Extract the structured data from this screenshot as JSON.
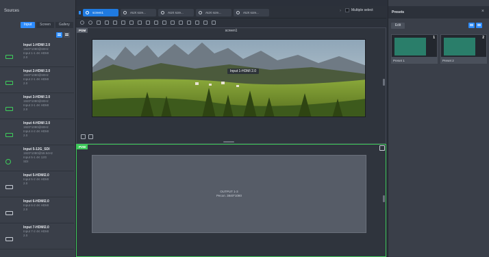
{
  "sources": {
    "title": "Sources",
    "tabs": [
      {
        "label": "Input",
        "active": true
      },
      {
        "label": "Screen",
        "active": false
      },
      {
        "label": "Gallery",
        "active": false
      }
    ],
    "items": [
      {
        "name": "Input 1-HDMI 2.0",
        "line1": "1920*1080@60Hz",
        "line2": "Input 1-1  4K  HDMI",
        "line3": "2.0",
        "icon": "hdmi-icon"
      },
      {
        "name": "Input 2-HDMI 2.0",
        "line1": "1920*1080@60Hz",
        "line2": "Input 2-1  4K  HDMI",
        "line3": "2.0",
        "icon": "hdmi-icon"
      },
      {
        "name": "Input 3-HDMI 2.0",
        "line1": "1920*1080@60Hz",
        "line2": "Input 3-1  4K  HDMI",
        "line3": "2.0",
        "icon": "hdmi-icon"
      },
      {
        "name": "Input 4-HDMI 2.0",
        "line1": "1920*1080@60Hz",
        "line2": "Input 4-2  4K  HDMI",
        "line3": "2.0",
        "icon": "hdmi-icon"
      },
      {
        "name": "Input 5-12G_SDI",
        "line1": "1920*1080@59.94Hz",
        "line2": "Input 5-1  4K  12G",
        "line3": "SDI",
        "icon": "sdi-icon"
      },
      {
        "name": "Input 5-HDMI2.0",
        "line1": "",
        "line2": "Input 5-2  4K  HDMI",
        "line3": "2.0",
        "icon": "monitor-icon"
      },
      {
        "name": "Input 6-HDMI2.0",
        "line1": "",
        "line2": "Input 6-2  4K  HDMI",
        "line3": "2.0",
        "icon": "monitor-icon"
      },
      {
        "name": "Input 7-HDMI2.0",
        "line1": "",
        "line2": "Input 7-2  4K  HDMI",
        "line3": "2.0",
        "icon": "monitor-icon"
      }
    ]
  },
  "topbar": {
    "screens": [
      {
        "label": "screen1",
        "active": true
      },
      {
        "label": "AUX scre...",
        "active": false
      },
      {
        "label": "AUX scre...",
        "active": false
      },
      {
        "label": "AUX scre...",
        "active": false
      },
      {
        "label": "AUX scre...",
        "active": false
      }
    ],
    "multiple_select": "Multiple select"
  },
  "pgm": {
    "tag": "PGM",
    "screen_title": "screen1",
    "layer_label": "Input 1-HDMI 2.0"
  },
  "pvw": {
    "tag": "PVW",
    "output_name": "OUTPUT 1-3",
    "output_res": "Ресол. 3840*1080"
  },
  "presets": {
    "title": "Presets",
    "close": "×",
    "edit_label": "Edit",
    "items": [
      {
        "label": "Preset 1",
        "number": "1"
      },
      {
        "label": "Preset 2",
        "number": "2"
      }
    ]
  },
  "colors": {
    "accent": "#2d8cff",
    "pvw_border": "#3ec95a",
    "panel_bg": "#3a3f49",
    "workspace_bg": "#2f343d"
  }
}
